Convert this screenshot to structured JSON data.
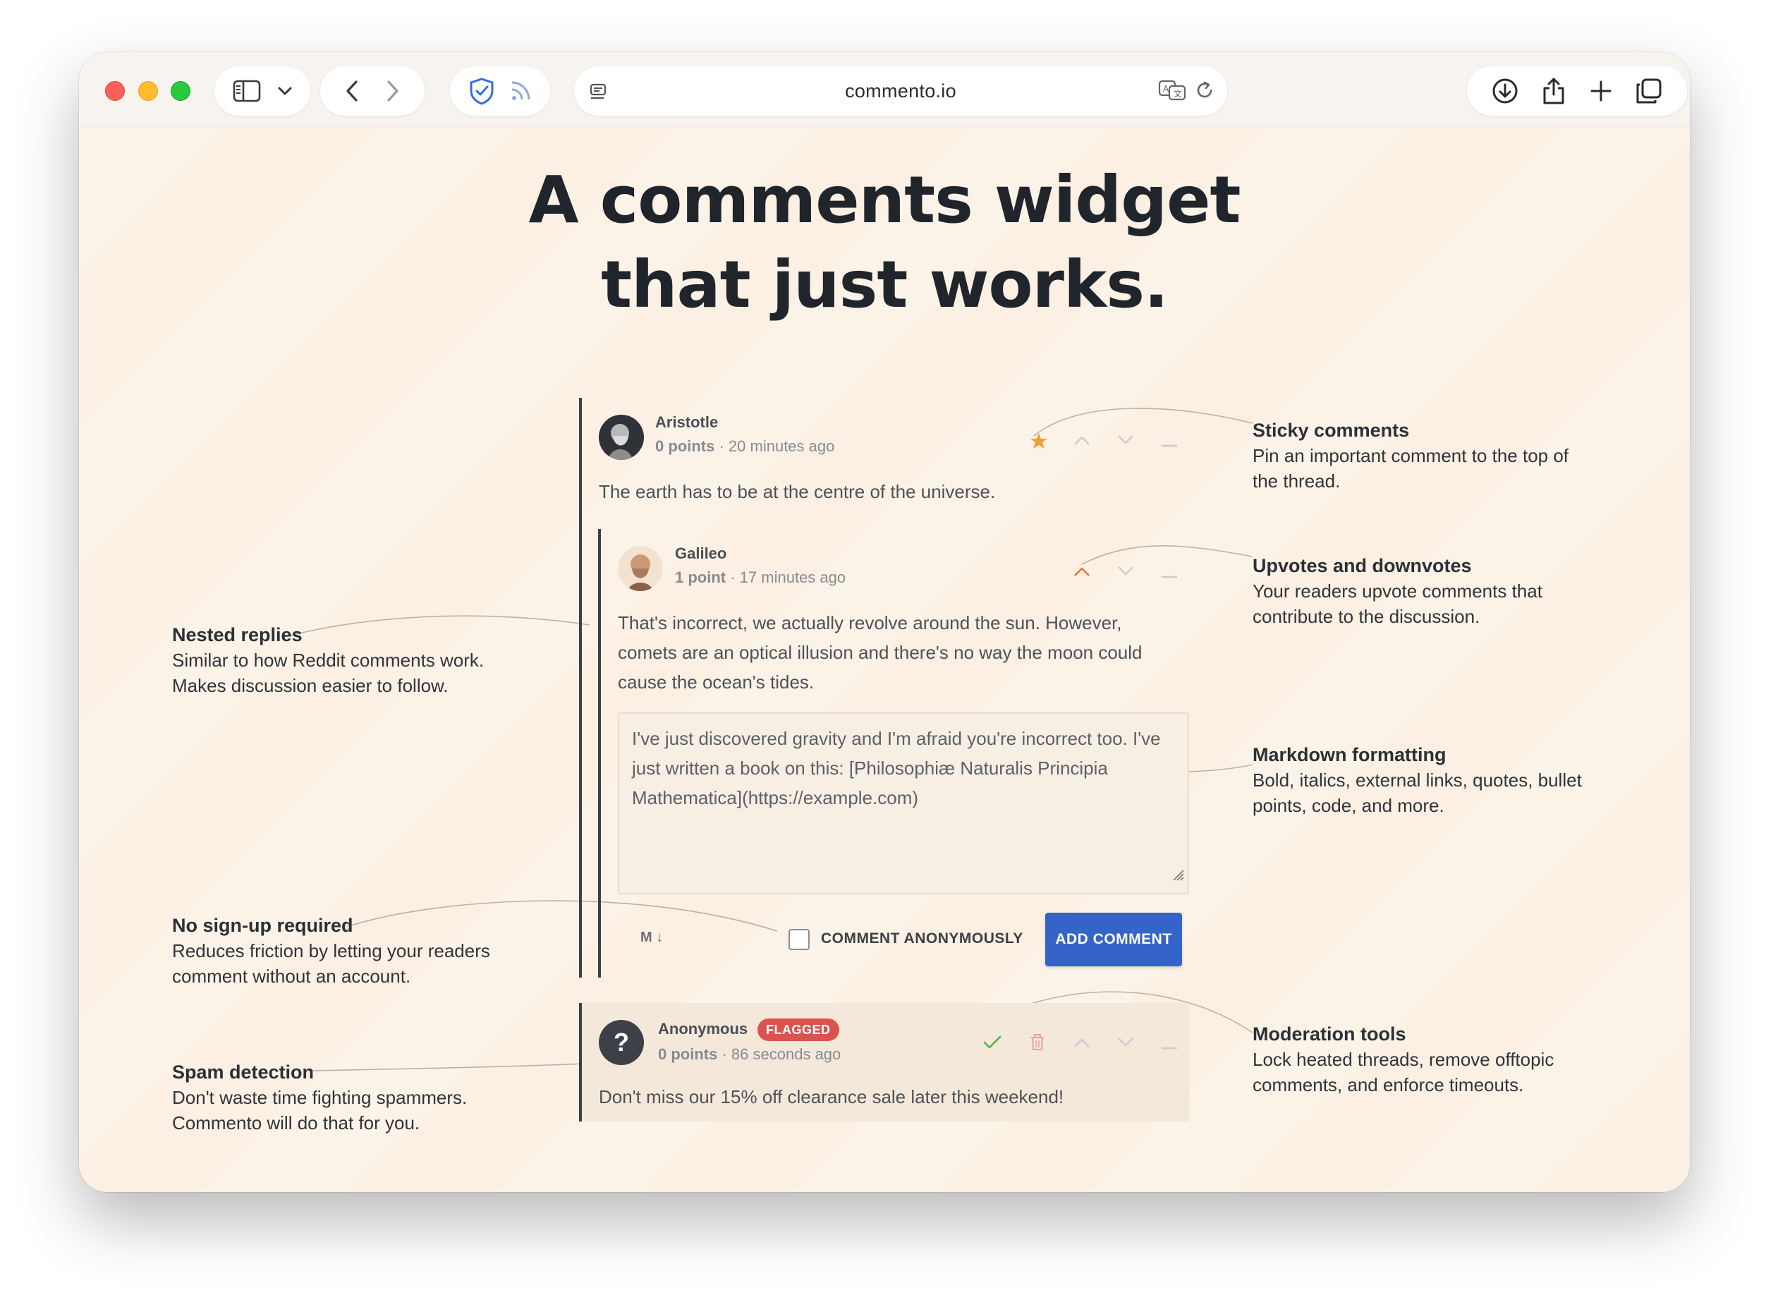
{
  "browser": {
    "url": "commento.io"
  },
  "hero": {
    "line1": "A comments widget",
    "line2": "that just works."
  },
  "features": {
    "sticky": {
      "title": "Sticky comments",
      "line1": "Pin an important comment to the top of",
      "line2": "the thread."
    },
    "votes": {
      "title": "Upvotes and downvotes",
      "line1": "Your readers upvote comments that",
      "line2": "contribute to the discussion."
    },
    "nested": {
      "title": "Nested replies",
      "line1": "Similar to how Reddit comments work.",
      "line2": "Makes discussion easier to follow."
    },
    "markdown": {
      "title": "Markdown formatting",
      "line1": "Bold, italics, external links, quotes, bullet",
      "line2": "points, code, and more."
    },
    "signup": {
      "title": "No sign-up required",
      "line1": "Reduces friction by letting your readers",
      "line2": "comment without an account."
    },
    "moderation": {
      "title": "Moderation tools",
      "line1": "Lock heated threads, remove offtopic",
      "line2": "comments, and enforce timeouts."
    },
    "spam": {
      "title": "Spam detection",
      "line1": "Don't waste time fighting spammers.",
      "line2": "Commento will do that for you."
    }
  },
  "comments": {
    "aristotle": {
      "author": "Aristotle",
      "points": "0 points",
      "sep": "·",
      "time": "20 minutes ago",
      "body": "The earth has to be at the centre of the universe."
    },
    "galileo": {
      "author": "Galileo",
      "points": "1 point",
      "sep": "·",
      "time": "17 minutes ago",
      "body_line1": "That's incorrect, we actually revolve around the sun. However,",
      "body_line2": "comets are an optical illusion and there's no way the moon could",
      "body_line3": "cause the ocean's tides."
    },
    "reply_box": {
      "line1": "I've just discovered gravity and I'm afraid you're incorrect too. I've",
      "line2": "just written a book on this: [Philosophiæ Naturalis Principia",
      "line3": "Mathematica](https://example.com)",
      "markdown_label": "M ↓",
      "anonymous_label": "COMMENT ANONYMOUSLY",
      "submit_label": "ADD COMMENT"
    },
    "anonymous": {
      "author": "Anonymous",
      "badge": "FLAGGED",
      "points": "0 points",
      "sep": "·",
      "time": "86 seconds ago",
      "body": "Don't miss our 15% off clearance sale later this weekend!",
      "avatar_glyph": "?"
    }
  },
  "colors": {
    "accent": "#3464c8",
    "sticky_star": "#f0a030",
    "upvote_active": "#e8743b",
    "approve": "#5cb85c",
    "flag": "#d9534f",
    "page_bg": "#fbf0e3"
  }
}
